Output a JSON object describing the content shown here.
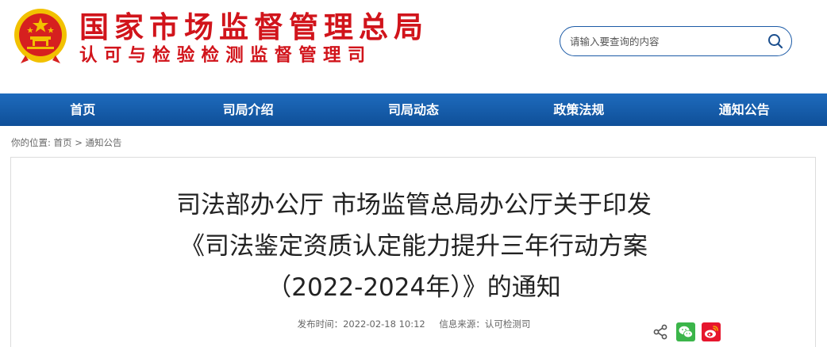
{
  "header": {
    "title": "国家市场监督管理总局",
    "subtitle": "认可与检验检测监督管理司"
  },
  "search": {
    "placeholder": "请输入要查询的内容"
  },
  "nav": {
    "items": [
      {
        "label": "首页"
      },
      {
        "label": "司局介绍"
      },
      {
        "label": "司局动态"
      },
      {
        "label": "政策法规"
      },
      {
        "label": "通知公告"
      }
    ]
  },
  "breadcrumb": {
    "prefix": "你的位置:",
    "home": "首页",
    "separator": ">",
    "current": "通知公告"
  },
  "article": {
    "title_line1": "司法部办公厅 市场监管总局办公厅关于印发",
    "title_line2": "《司法鉴定资质认定能力提升三年行动方案",
    "title_line3": "（2022-2024年）》的通知",
    "publish_time": "发布时间：2022-02-18 10:12",
    "source": "信息来源：认可检测司"
  },
  "colors": {
    "brand_red": "#d1141b",
    "nav_blue": "#1460ad",
    "wechat_green": "#3bb54a",
    "weibo_red": "#e6162d"
  }
}
